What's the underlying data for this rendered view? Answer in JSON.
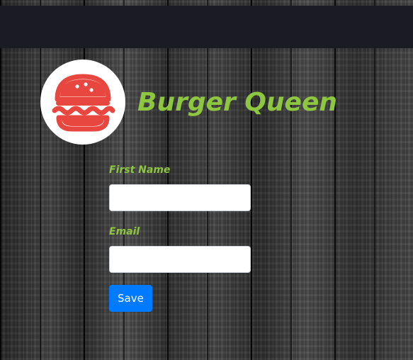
{
  "brand": {
    "title": "Burger Queen",
    "logo_icon": "burger-icon",
    "logo_color": "#e8473f",
    "title_color": "#8dc63f"
  },
  "form": {
    "first_name_label": "First Name",
    "first_name_value": "",
    "first_name_placeholder": "",
    "email_label": "Email",
    "email_value": "",
    "email_placeholder": "",
    "save_label": "Save",
    "save_color": "#007bff"
  }
}
